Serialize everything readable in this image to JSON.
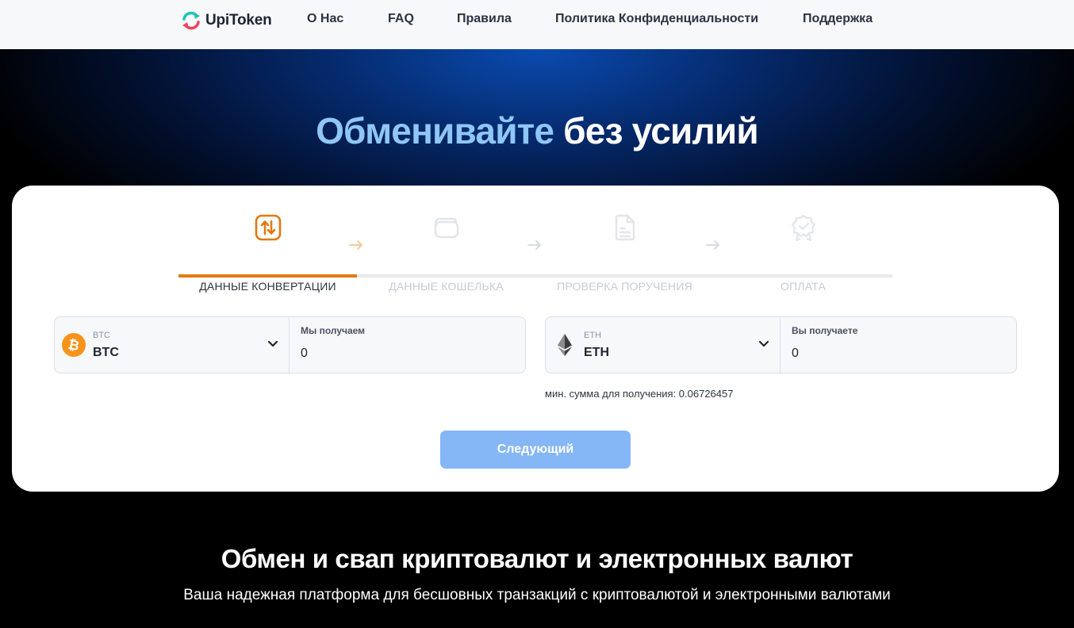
{
  "brand": {
    "name": "UpiToken"
  },
  "nav": {
    "items": [
      "О Нас",
      "FAQ",
      "Правила",
      "Политика Конфиденциальности",
      "Поддержка"
    ]
  },
  "hero": {
    "title_highlight": "Обменивайте",
    "title_rest": "без усилий"
  },
  "steps": [
    {
      "label": "ДАННЫЕ КОНВЕРТАЦИИ",
      "icon": "swap-arrows-icon",
      "active": true
    },
    {
      "label": "ДАННЫЕ КОШЕЛЬКА",
      "icon": "wallet-icon",
      "active": false
    },
    {
      "label": "ПРОВЕРКА ПОРУЧЕНИЯ",
      "icon": "document-icon",
      "active": false
    },
    {
      "label": "ОПЛАТА",
      "icon": "award-badge-icon",
      "active": false
    }
  ],
  "send": {
    "currency_code": "BTC",
    "currency_name": "BTC",
    "amount_label": "Мы получаем",
    "amount_value": "0",
    "icon": "bitcoin-icon"
  },
  "receive": {
    "currency_code": "ETH",
    "currency_name": "ETH",
    "amount_label": "Вы получаете",
    "amount_value": "0",
    "icon": "ethereum-icon"
  },
  "min_note": "мин. сумма для получения: 0.06726457",
  "next_button": "Следующий",
  "section": {
    "title": "Обмен и свап криптовалют и электронных валют",
    "subtitle": "Ваша надежная платформа для бесшовных транзакций с криптовалютой и электронными валютами"
  },
  "colors": {
    "accent": "#e07a12",
    "button": "#85b6f6",
    "hero_highlight": "#8fc6f5",
    "bitcoin": "#f7931a"
  }
}
